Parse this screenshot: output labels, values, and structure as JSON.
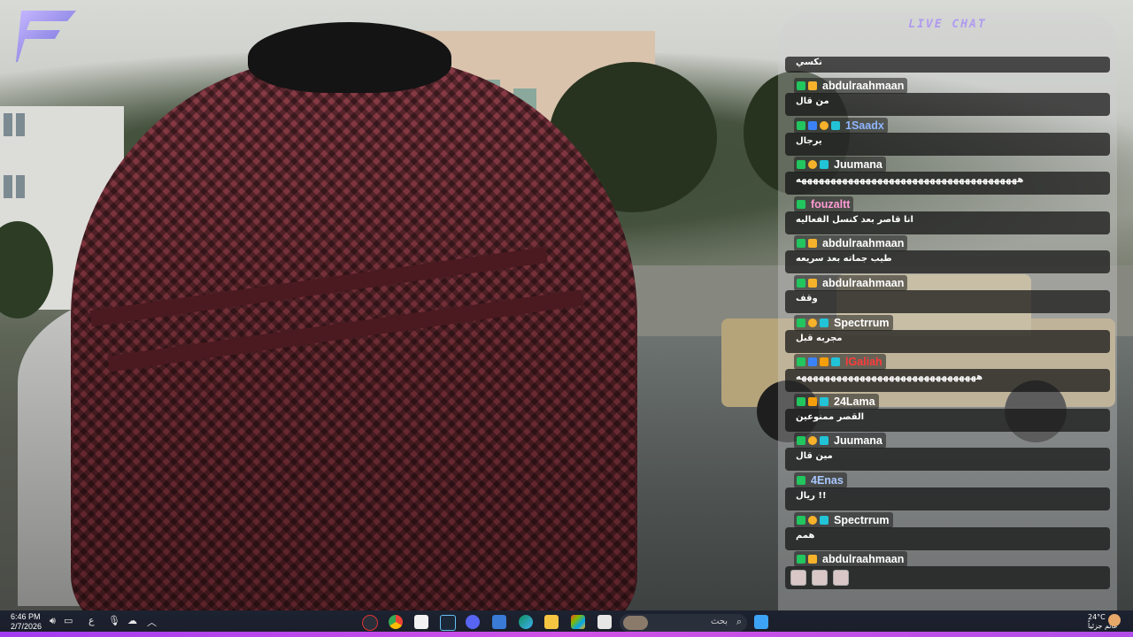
{
  "chat": {
    "title": "LIVE CHAT",
    "top_partial_text": "نكسي",
    "messages": [
      {
        "user": "abdulraahmaan",
        "color": "#ffffff",
        "badges": [
          "k",
          "m"
        ],
        "text": "من قال"
      },
      {
        "user": "1Saadx",
        "color": "#8fb6ff",
        "badges": [
          "k",
          "b",
          "1",
          "t"
        ],
        "text": "يرجال"
      },
      {
        "user": "Juumana",
        "color": "#ffffff",
        "badges": [
          "k",
          "1",
          "t"
        ],
        "text": "ههههههههههههههههههههههههههههههههههههههه"
      },
      {
        "user": "fouzaltt",
        "color": "#ff9ad5",
        "badges": [
          "k"
        ],
        "text": "انا قاصر بعد كنسل الفعاليه"
      },
      {
        "user": "abdulraahmaan",
        "color": "#ffffff",
        "badges": [
          "k",
          "m"
        ],
        "text": "طيب جماته بعد سريعه"
      },
      {
        "user": "abdulraahmaan",
        "color": "#ffffff",
        "badges": [
          "k",
          "m"
        ],
        "text": "وقف"
      },
      {
        "user": "Spectrrum",
        "color": "#ffffff",
        "badges": [
          "k",
          "1",
          "t"
        ],
        "text": "مجربه قبل"
      },
      {
        "user": "lGaliah",
        "color": "#ff3b3b",
        "badges": [
          "k",
          "b",
          "f",
          "t"
        ],
        "text": "هههههههههههههههههههههههههههههههه"
      },
      {
        "user": "24Lama",
        "color": "#ffffff",
        "badges": [
          "k",
          "f",
          "t"
        ],
        "text": "القصر ممنوعين"
      },
      {
        "user": "Juumana",
        "color": "#ffffff",
        "badges": [
          "k",
          "1",
          "t"
        ],
        "text": "مين قال"
      },
      {
        "user": "4Enas",
        "color": "#a8c8ff",
        "badges": [
          "k"
        ],
        "text": "!! ريال"
      },
      {
        "user": "Spectrrum",
        "color": "#ffffff",
        "badges": [
          "k",
          "1",
          "t"
        ],
        "text": "همم"
      },
      {
        "user": "abdulraahmaan",
        "color": "#ffffff",
        "badges": [
          "k",
          "m"
        ],
        "text": "",
        "emotes": 3
      }
    ]
  },
  "taskbar": {
    "time": "6:46 PM",
    "date": "2/7/2026",
    "lang": "ع",
    "search_placeholder": "بحث",
    "weather_temp": "24°C",
    "weather_desc": "غائم جزئياً"
  }
}
